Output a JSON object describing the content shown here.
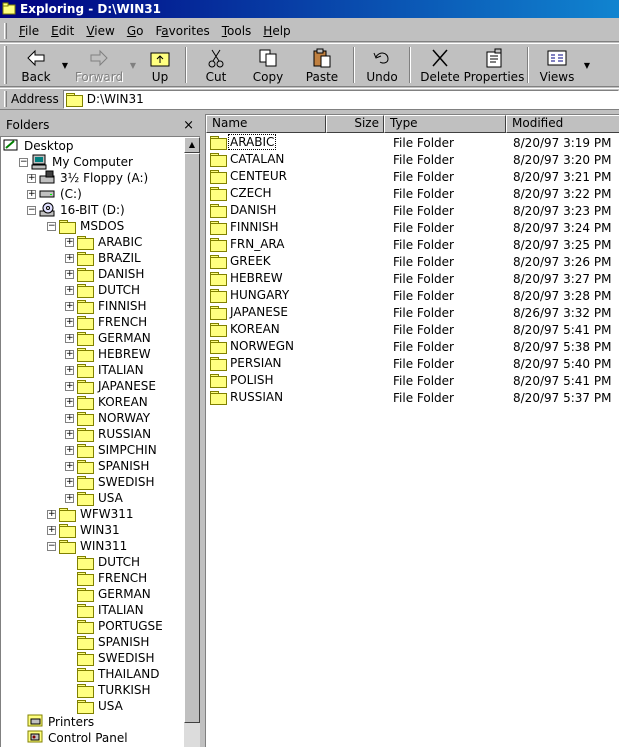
{
  "window": {
    "title": "Exploring - D:\\WIN31"
  },
  "menu": [
    {
      "label": "File",
      "key": "F",
      "rest": "ile"
    },
    {
      "label": "Edit",
      "key": "E",
      "rest": "dit"
    },
    {
      "label": "View",
      "key": "V",
      "rest": "iew"
    },
    {
      "label": "Go",
      "key": "G",
      "rest": "o"
    },
    {
      "label": "Favorites",
      "key": "F",
      "rest": "avorites",
      "pre": "Fa",
      "k2": "v",
      "r2": "orites"
    },
    {
      "label": "Tools",
      "key": "T",
      "rest": "ools"
    },
    {
      "label": "Help",
      "key": "H",
      "rest": "elp"
    }
  ],
  "toolbar": {
    "back": "Back",
    "forward": "Forward",
    "up": "Up",
    "cut": "Cut",
    "copy": "Copy",
    "paste": "Paste",
    "undo": "Undo",
    "delete": "Delete",
    "properties": "Properties",
    "views": "Views"
  },
  "address": {
    "label": "Address",
    "value": "D:\\WIN31"
  },
  "folders_pane": {
    "title": "Folders",
    "close": "×"
  },
  "tree": [
    {
      "label": "Desktop",
      "icon": "desktop-icon",
      "level": 0,
      "expander": "none"
    },
    {
      "label": "My Computer",
      "icon": "computer-icon",
      "level": 1,
      "expander": "minus"
    },
    {
      "label": "3½ Floppy (A:)",
      "icon": "floppy-icon",
      "level": 2,
      "expander": "plus"
    },
    {
      "label": "(C:)",
      "icon": "drive-icon",
      "level": 2,
      "expander": "plus"
    },
    {
      "label": "16-BIT (D:)",
      "icon": "cdrom-icon",
      "level": 2,
      "expander": "minus"
    },
    {
      "label": "MSDOS",
      "icon": "folder-icon",
      "level": 3,
      "expander": "minus"
    },
    {
      "label": "ARABIC",
      "icon": "folder-icon",
      "level": 4,
      "expander": "plus"
    },
    {
      "label": "BRAZIL",
      "icon": "folder-icon",
      "level": 4,
      "expander": "plus"
    },
    {
      "label": "DANISH",
      "icon": "folder-icon",
      "level": 4,
      "expander": "plus"
    },
    {
      "label": "DUTCH",
      "icon": "folder-icon",
      "level": 4,
      "expander": "plus"
    },
    {
      "label": "FINNISH",
      "icon": "folder-icon",
      "level": 4,
      "expander": "plus"
    },
    {
      "label": "FRENCH",
      "icon": "folder-icon",
      "level": 4,
      "expander": "plus"
    },
    {
      "label": "GERMAN",
      "icon": "folder-icon",
      "level": 4,
      "expander": "plus"
    },
    {
      "label": "HEBREW",
      "icon": "folder-icon",
      "level": 4,
      "expander": "plus"
    },
    {
      "label": "ITALIAN",
      "icon": "folder-icon",
      "level": 4,
      "expander": "plus"
    },
    {
      "label": "JAPANESE",
      "icon": "folder-icon",
      "level": 4,
      "expander": "plus"
    },
    {
      "label": "KOREAN",
      "icon": "folder-icon",
      "level": 4,
      "expander": "plus"
    },
    {
      "label": "NORWAY",
      "icon": "folder-icon",
      "level": 4,
      "expander": "plus"
    },
    {
      "label": "RUSSIAN",
      "icon": "folder-icon",
      "level": 4,
      "expander": "plus"
    },
    {
      "label": "SIMPCHIN",
      "icon": "folder-icon",
      "level": 4,
      "expander": "plus"
    },
    {
      "label": "SPANISH",
      "icon": "folder-icon",
      "level": 4,
      "expander": "plus"
    },
    {
      "label": "SWEDISH",
      "icon": "folder-icon",
      "level": 4,
      "expander": "plus"
    },
    {
      "label": "USA",
      "icon": "folder-icon",
      "level": 4,
      "expander": "plus"
    },
    {
      "label": "WFW311",
      "icon": "folder-icon",
      "level": 3,
      "expander": "plus"
    },
    {
      "label": "WIN31",
      "icon": "folder-open-icon",
      "level": 3,
      "expander": "plus"
    },
    {
      "label": "WIN311",
      "icon": "folder-icon",
      "level": 3,
      "expander": "minus"
    },
    {
      "label": "DUTCH",
      "icon": "folder-icon",
      "level": 4,
      "expander": "none"
    },
    {
      "label": "FRENCH",
      "icon": "folder-icon",
      "level": 4,
      "expander": "none"
    },
    {
      "label": "GERMAN",
      "icon": "folder-icon",
      "level": 4,
      "expander": "none"
    },
    {
      "label": "ITALIAN",
      "icon": "folder-icon",
      "level": 4,
      "expander": "none"
    },
    {
      "label": "PORTUGSE",
      "icon": "folder-icon",
      "level": 4,
      "expander": "none"
    },
    {
      "label": "SPANISH",
      "icon": "folder-icon",
      "level": 4,
      "expander": "none"
    },
    {
      "label": "SWEDISH",
      "icon": "folder-icon",
      "level": 4,
      "expander": "none"
    },
    {
      "label": "THAILAND",
      "icon": "folder-icon",
      "level": 4,
      "expander": "none"
    },
    {
      "label": "TURKISH",
      "icon": "folder-icon",
      "level": 4,
      "expander": "none"
    },
    {
      "label": "USA",
      "icon": "folder-icon",
      "level": 4,
      "expander": "none"
    },
    {
      "label": "Printers",
      "icon": "printer-icon",
      "level": 2,
      "expander": "none"
    },
    {
      "label": "Control Panel",
      "icon": "control-panel-icon",
      "level": 2,
      "expander": "none"
    }
  ],
  "list": {
    "columns": [
      "Name",
      "Size",
      "Type",
      "Modified"
    ],
    "rows": [
      {
        "name": "ARABIC",
        "size": "",
        "type": "File Folder",
        "modified": "8/20/97 3:19 PM"
      },
      {
        "name": "CATALAN",
        "size": "",
        "type": "File Folder",
        "modified": "8/20/97 3:20 PM"
      },
      {
        "name": "CENTEUR",
        "size": "",
        "type": "File Folder",
        "modified": "8/20/97 3:21 PM"
      },
      {
        "name": "CZECH",
        "size": "",
        "type": "File Folder",
        "modified": "8/20/97 3:22 PM"
      },
      {
        "name": "DANISH",
        "size": "",
        "type": "File Folder",
        "modified": "8/20/97 3:23 PM"
      },
      {
        "name": "FINNISH",
        "size": "",
        "type": "File Folder",
        "modified": "8/20/97 3:24 PM"
      },
      {
        "name": "FRN_ARA",
        "size": "",
        "type": "File Folder",
        "modified": "8/20/97 3:25 PM"
      },
      {
        "name": "GREEK",
        "size": "",
        "type": "File Folder",
        "modified": "8/20/97 3:26 PM"
      },
      {
        "name": "HEBREW",
        "size": "",
        "type": "File Folder",
        "modified": "8/20/97 3:27 PM"
      },
      {
        "name": "HUNGARY",
        "size": "",
        "type": "File Folder",
        "modified": "8/20/97 3:28 PM"
      },
      {
        "name": "JAPANESE",
        "size": "",
        "type": "File Folder",
        "modified": "8/26/97 3:32 PM"
      },
      {
        "name": "KOREAN",
        "size": "",
        "type": "File Folder",
        "modified": "8/20/97 5:41 PM"
      },
      {
        "name": "NORWEGN",
        "size": "",
        "type": "File Folder",
        "modified": "8/20/97 5:38 PM"
      },
      {
        "name": "PERSIAN",
        "size": "",
        "type": "File Folder",
        "modified": "8/20/97 5:40 PM"
      },
      {
        "name": "POLISH",
        "size": "",
        "type": "File Folder",
        "modified": "8/20/97 5:41 PM"
      },
      {
        "name": "RUSSIAN",
        "size": "",
        "type": "File Folder",
        "modified": "8/20/97 5:37 PM"
      }
    ]
  },
  "colors": {
    "face": "#c0c0c0",
    "title_start": "#000080",
    "title_end": "#1084d0",
    "folder": "#ffff80"
  }
}
